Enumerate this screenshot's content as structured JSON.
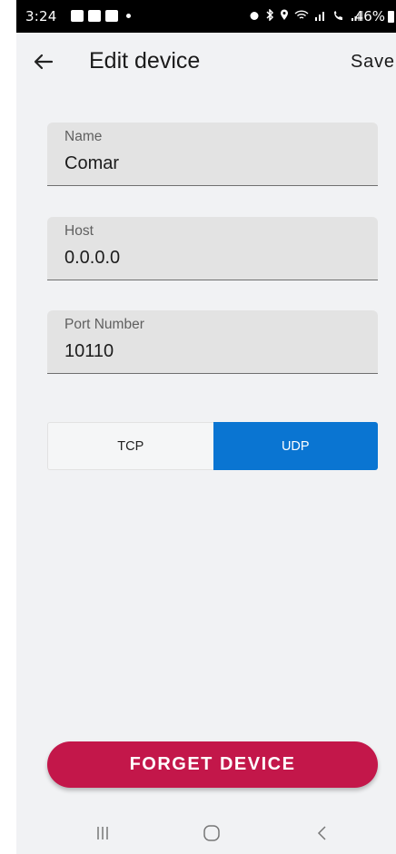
{
  "status_bar": {
    "time": "3:24",
    "battery": "46%"
  },
  "appbar": {
    "title": "Edit device",
    "save_label": "Save",
    "back_icon": "arrow-left-icon"
  },
  "fields": {
    "name": {
      "label": "Name",
      "value": "Comar"
    },
    "host": {
      "label": "Host",
      "value": "0.0.0.0"
    },
    "port": {
      "label": "Port Number",
      "value": "10110"
    }
  },
  "protocol": {
    "options": [
      "TCP",
      "UDP"
    ],
    "selected": "UDP"
  },
  "forget_button": {
    "label": "FORGET DEVICE"
  },
  "colors": {
    "accent": "#0a75d2",
    "danger": "#c3174a",
    "background": "#f1f2f4",
    "field_bg": "#e3e3e3"
  },
  "nav_bar": {
    "icons": [
      "recents-icon",
      "home-icon",
      "back-icon"
    ]
  }
}
